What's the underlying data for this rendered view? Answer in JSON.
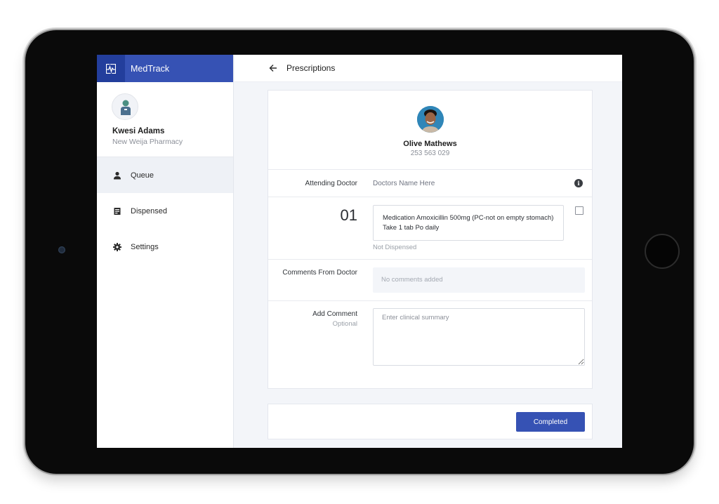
{
  "app": {
    "name": "MedTrack",
    "brand_color": "#3652b4"
  },
  "user": {
    "name": "Kwesi Adams",
    "pharmacy": "New Weija Pharmacy"
  },
  "sidebar": {
    "items": [
      {
        "label": "Queue",
        "icon": "person-icon",
        "active": true
      },
      {
        "label": "Dispensed",
        "icon": "receipt-icon",
        "active": false
      },
      {
        "label": "Settings",
        "icon": "gear-icon",
        "active": false
      }
    ]
  },
  "header": {
    "title": "Prescriptions"
  },
  "patient": {
    "name": "Olive Mathews",
    "phone": "253 563 029"
  },
  "prescription": {
    "attending_doctor_label": "Attending Doctor",
    "attending_doctor_value": "Doctors Name Here",
    "number": "01",
    "medication_line1": "Medication Amoxicillin 500mg (PC-not on empty stomach)",
    "medication_line2": "Take 1 tab Po daily",
    "status": "Not Dispensed",
    "comments_label": "Comments From Doctor",
    "comments_value": "No comments added",
    "add_comment_label": "Add Comment",
    "add_comment_optional": "Optional",
    "add_comment_placeholder": "Enter clinical summary"
  },
  "actions": {
    "complete_label": "Completed"
  }
}
